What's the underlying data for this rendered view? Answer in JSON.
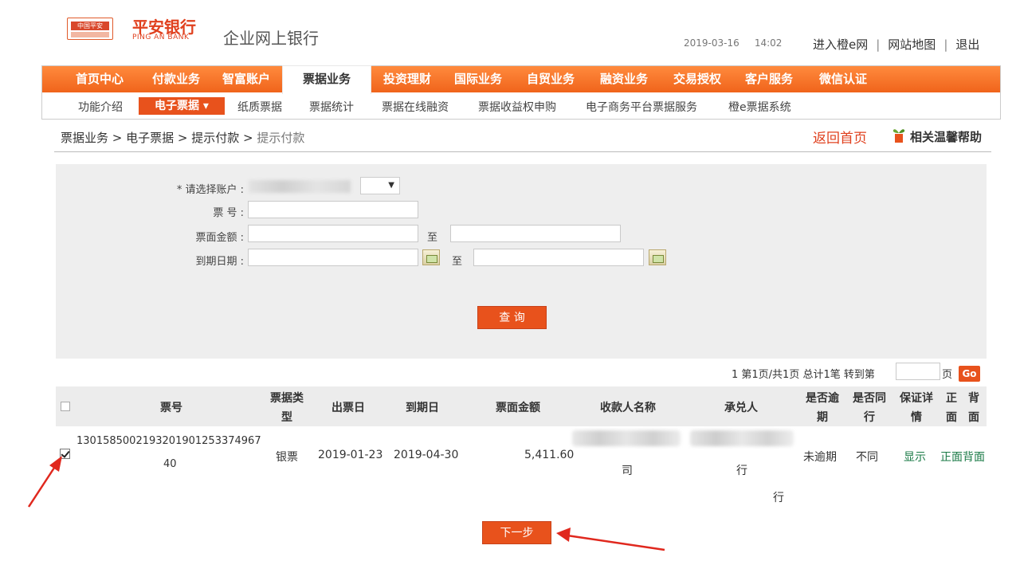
{
  "header": {
    "logo_text": "中国平安",
    "bank_name": "平安银行",
    "bank_name_en": "PING AN BANK",
    "product": "企业网上银行",
    "date": "2019-03-16",
    "time": "14:02",
    "links": [
      "进入橙e网",
      "网站地图",
      "退出"
    ]
  },
  "nav": {
    "main": [
      "首页中心",
      "付款业务",
      "智富账户",
      "票据业务",
      "投资理财",
      "国际业务",
      "自贸业务",
      "融资业务",
      "交易授权",
      "客户服务",
      "微信认证"
    ],
    "active_index": 3,
    "sub": [
      "功能介绍",
      "电子票据",
      "纸质票据",
      "票据统计",
      "票据在线融资",
      "票据收益权申购",
      "电子商务平台票据服务",
      "橙e票据系统"
    ],
    "sub_active": "电子票据 ▾"
  },
  "breadcrumb": {
    "items": [
      "票据业务",
      "电子票据",
      "提示付款",
      "提示付款"
    ],
    "separator": " > "
  },
  "actions": {
    "home": "返回首页",
    "help": "相关温馨帮助"
  },
  "form": {
    "account_label": "* 请选择账户 :",
    "bill_no_label": "票  号 :",
    "amount_label": "票面金额 :",
    "due_date_label": "到期日期 :",
    "to_label": "至",
    "select_arrow": "▼",
    "query_button": "查 询"
  },
  "pager": {
    "text": "1  第1页/共1页 总计1笔 转到第",
    "page_suffix": "页",
    "go": "Go"
  },
  "table": {
    "headers": {
      "bill_no": "票号",
      "bill_type_1": "票据类",
      "bill_type_2": "型",
      "issue_date": "出票日",
      "due_date": "到期日",
      "amount": "票面金额",
      "payee": "收款人名称",
      "acceptor": "承兑人",
      "overdue_1": "是否逾",
      "overdue_2": "期",
      "same_bank_1": "是否同",
      "same_bank_2": "行",
      "guarantee_1": "保证详",
      "guarantee_2": "情",
      "front_1": "正",
      "front_2": "面",
      "back_1": "背",
      "back_2": "面"
    },
    "row": {
      "bill_no_1": "1301585002193201901253374967",
      "bill_no_2": "40",
      "bill_type": "银票",
      "issue_date": "2019-01-23",
      "due_date": "2019-04-30",
      "amount": "5,411.60",
      "payee_tail": "司",
      "acceptor_tail_1": "行",
      "acceptor_tail_2": "行",
      "overdue": "未逾期",
      "same_bank": "不同",
      "guarantee": "显示",
      "front": "正面",
      "back": "背面"
    }
  },
  "next_button": "下一步",
  "colors": {
    "accent": "#e8521c",
    "nav_top": "#ff8a3d",
    "nav_bottom": "#f0641b",
    "link_green": "#1a7a46",
    "panel": "#eeeeee",
    "arrow": "#e0281e"
  }
}
